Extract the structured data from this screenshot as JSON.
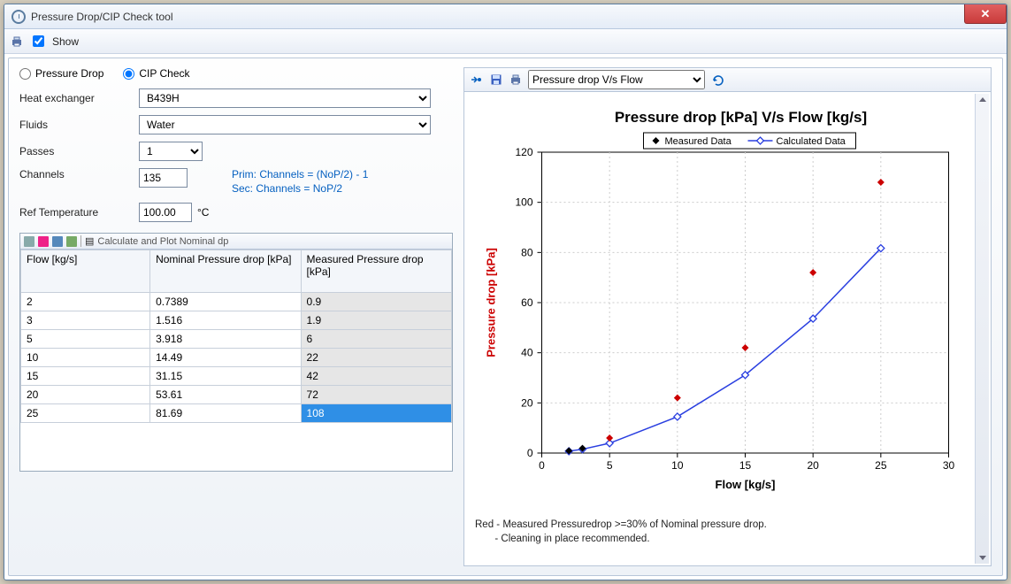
{
  "window": {
    "title": "Pressure Drop/CIP Check tool"
  },
  "menubar": {
    "show_label": "Show"
  },
  "mode": {
    "pressure_drop_label": "Pressure Drop",
    "cip_check_label": "CIP Check",
    "pressure_drop_checked": false,
    "cip_check_checked": true
  },
  "form": {
    "heat_exchanger_label": "Heat exchanger",
    "heat_exchanger_value": "B439H",
    "fluids_label": "Fluids",
    "fluids_value": "Water",
    "passes_label": "Passes",
    "passes_value": "1",
    "channels_label": "Channels",
    "channels_value": "135",
    "channels_hint1": "Prim: Channels = (NoP/2) - 1",
    "channels_hint2": "Sec: Channels = NoP/2",
    "ref_temp_label": "Ref Temperature",
    "ref_temp_value": "100.00",
    "ref_temp_unit": "°C",
    "toolbar_hint": "Calculate and Plot Nominal dp"
  },
  "table": {
    "col_flow": "Flow [kg/s]",
    "col_nominal": "Nominal Pressure drop [kPa]",
    "col_measured": "Measured Pressure drop [kPa]",
    "rows": [
      {
        "flow": "2",
        "nominal": "0.7389",
        "measured": "0.9"
      },
      {
        "flow": "3",
        "nominal": "1.516",
        "measured": "1.9"
      },
      {
        "flow": "5",
        "nominal": "3.918",
        "measured": "6"
      },
      {
        "flow": "10",
        "nominal": "14.49",
        "measured": "22"
      },
      {
        "flow": "15",
        "nominal": "31.15",
        "measured": "42"
      },
      {
        "flow": "20",
        "nominal": "53.61",
        "measured": "72"
      },
      {
        "flow": "25",
        "nominal": "81.69",
        "measured": "108"
      }
    ],
    "selected_row": 6
  },
  "chart_toolbar": {
    "dropdown_value": "Pressure drop V/s Flow"
  },
  "chart_footer": {
    "line1": "Red - Measured Pressuredrop >=30% of Nominal pressure drop.",
    "line2": "       - Cleaning in place recommended."
  },
  "chart_data": {
    "type": "line",
    "title": "Pressure drop [kPa]  V/s  Flow [kg/s]",
    "xlabel": "Flow [kg/s]",
    "ylabel": "Pressure drop [kPa]",
    "xlim": [
      0,
      30
    ],
    "ylim": [
      0,
      120
    ],
    "xticks": [
      0,
      5,
      10,
      15,
      20,
      25,
      30
    ],
    "yticks": [
      0,
      20,
      40,
      60,
      80,
      100,
      120
    ],
    "series": [
      {
        "name": "Calculated Data",
        "style": "line-open-diamond",
        "x": [
          2,
          3,
          5,
          10,
          15,
          20,
          25
        ],
        "y": [
          0.74,
          1.52,
          3.92,
          14.49,
          31.15,
          53.61,
          81.69
        ]
      },
      {
        "name": "Measured Data",
        "style": "diamond-points",
        "x": [
          2,
          3,
          5,
          10,
          15,
          20,
          25
        ],
        "y": [
          0.9,
          1.9,
          6,
          22,
          42,
          72,
          108
        ],
        "colors": [
          "black",
          "black",
          "red",
          "red",
          "red",
          "red",
          "red"
        ]
      }
    ],
    "legend": [
      "Measured Data",
      "Calculated Data"
    ]
  }
}
